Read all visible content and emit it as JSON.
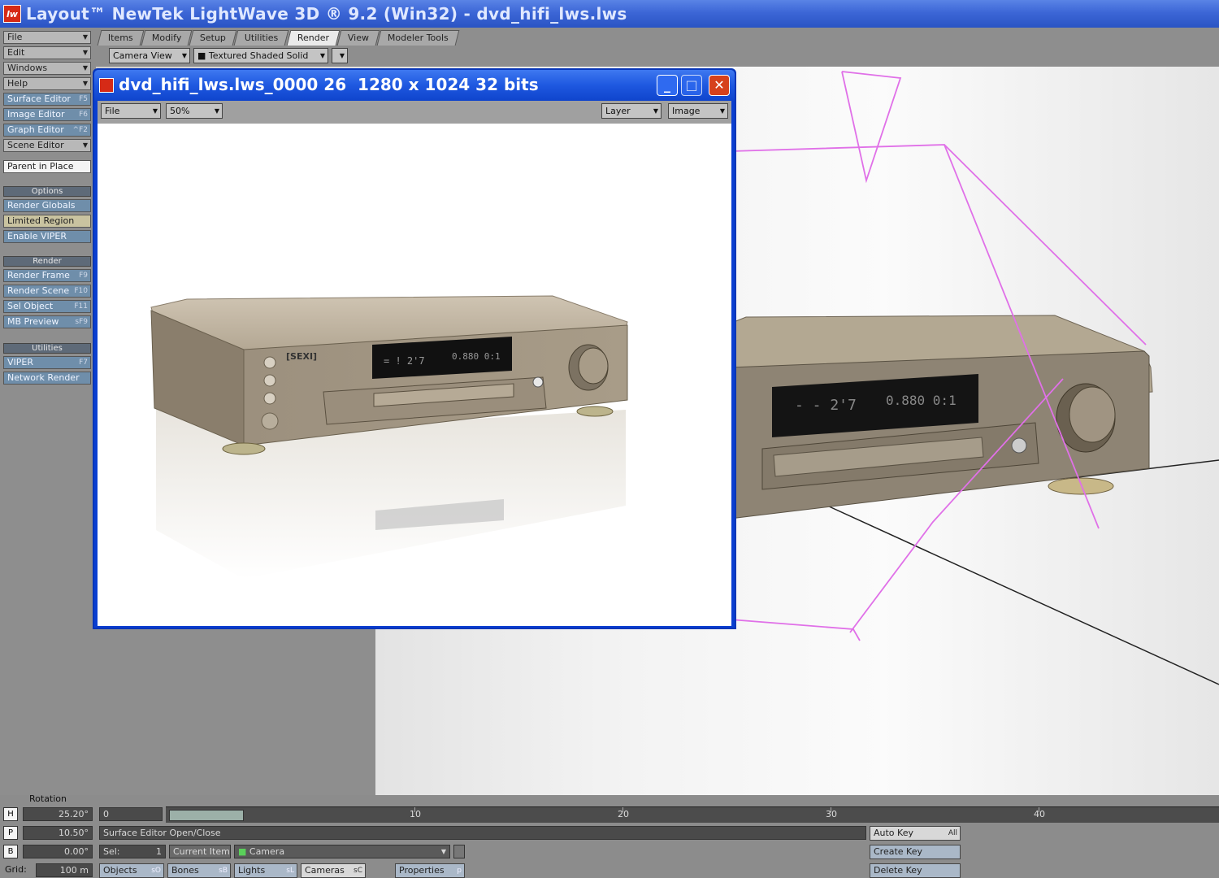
{
  "app": {
    "title": "Layout™ NewTek LightWave 3D ® 9.2 (Win32) - dvd_hifi_lws.lws",
    "logo": "lw"
  },
  "left_toolbar": {
    "menus": [
      "File",
      "Edit",
      "Windows",
      "Help"
    ],
    "editors": [
      {
        "label": "Surface Editor",
        "key": "F5"
      },
      {
        "label": "Image Editor",
        "key": "F6"
      },
      {
        "label": "Graph Editor",
        "key": "^F2"
      },
      {
        "label": "Scene Editor",
        "key": ""
      }
    ],
    "parent_in_place": "Parent in Place",
    "options_header": "Options",
    "options": [
      {
        "label": "Render Globals",
        "key": ""
      },
      {
        "label": "Limited Region",
        "key": ""
      },
      {
        "label": "Enable VIPER",
        "key": ""
      }
    ],
    "render_header": "Render",
    "render_items": [
      {
        "label": "Render Frame",
        "key": "F9"
      },
      {
        "label": "Render Scene",
        "key": "F10"
      },
      {
        "label": "Sel Object",
        "key": "F11"
      },
      {
        "label": "MB Preview",
        "key": "sF9"
      }
    ],
    "utilities_header": "Utilities",
    "utilities": [
      {
        "label": "VIPER",
        "key": "F7"
      },
      {
        "label": "Network Render",
        "key": ""
      }
    ]
  },
  "tabs": [
    {
      "label": "Items",
      "active": false
    },
    {
      "label": "Modify",
      "active": false
    },
    {
      "label": "Setup",
      "active": false
    },
    {
      "label": "Utilities",
      "active": false
    },
    {
      "label": "Render",
      "active": true
    },
    {
      "label": "View",
      "active": false
    },
    {
      "label": "Modeler Tools",
      "active": false
    }
  ],
  "viewport": {
    "view_mode": "Camera View",
    "shading_mode": "Textured Shaded Solid"
  },
  "render_window": {
    "title": "dvd_hifi_lws.lws_0000 26  1280 x 1024 32 bits",
    "file_menu": "File",
    "zoom": "50%",
    "layer_menu": "Layer",
    "image_menu": "Image",
    "buttons": {
      "minimize": "_",
      "maximize": "□",
      "close": "✕"
    }
  },
  "bottom": {
    "rotation_label": "Rotation",
    "h_label": "H",
    "h_value": "25.20°",
    "p_label": "P",
    "p_value": "10.50°",
    "b_label": "B",
    "b_value": "0.00°",
    "grid_label": "Grid:",
    "grid_value": "100 m",
    "current_frame": "0",
    "status_message": "Surface Editor Open/Close",
    "sel_label": "Sel:",
    "sel_value": "1",
    "current_item_label": "Current Item",
    "current_item_value": "Camera",
    "objects": "Objects",
    "objects_key": "sO",
    "bones": "Bones",
    "bones_key": "sB",
    "lights": "Lights",
    "lights_key": "sL",
    "cameras": "Cameras",
    "cameras_key": "sC",
    "properties": "Properties",
    "properties_key": "p",
    "auto_key": "Auto Key",
    "auto_key_value": "All",
    "create_key": "Create Key",
    "delete_key": "Delete Key",
    "timeline_ticks": [
      "10",
      "20",
      "30",
      "40"
    ]
  },
  "colors": {
    "title_bar": "#3c66d6",
    "curve_magenta": "#e070e8",
    "product_body": "#a89a88",
    "display_panel": "#1a1a1a"
  }
}
